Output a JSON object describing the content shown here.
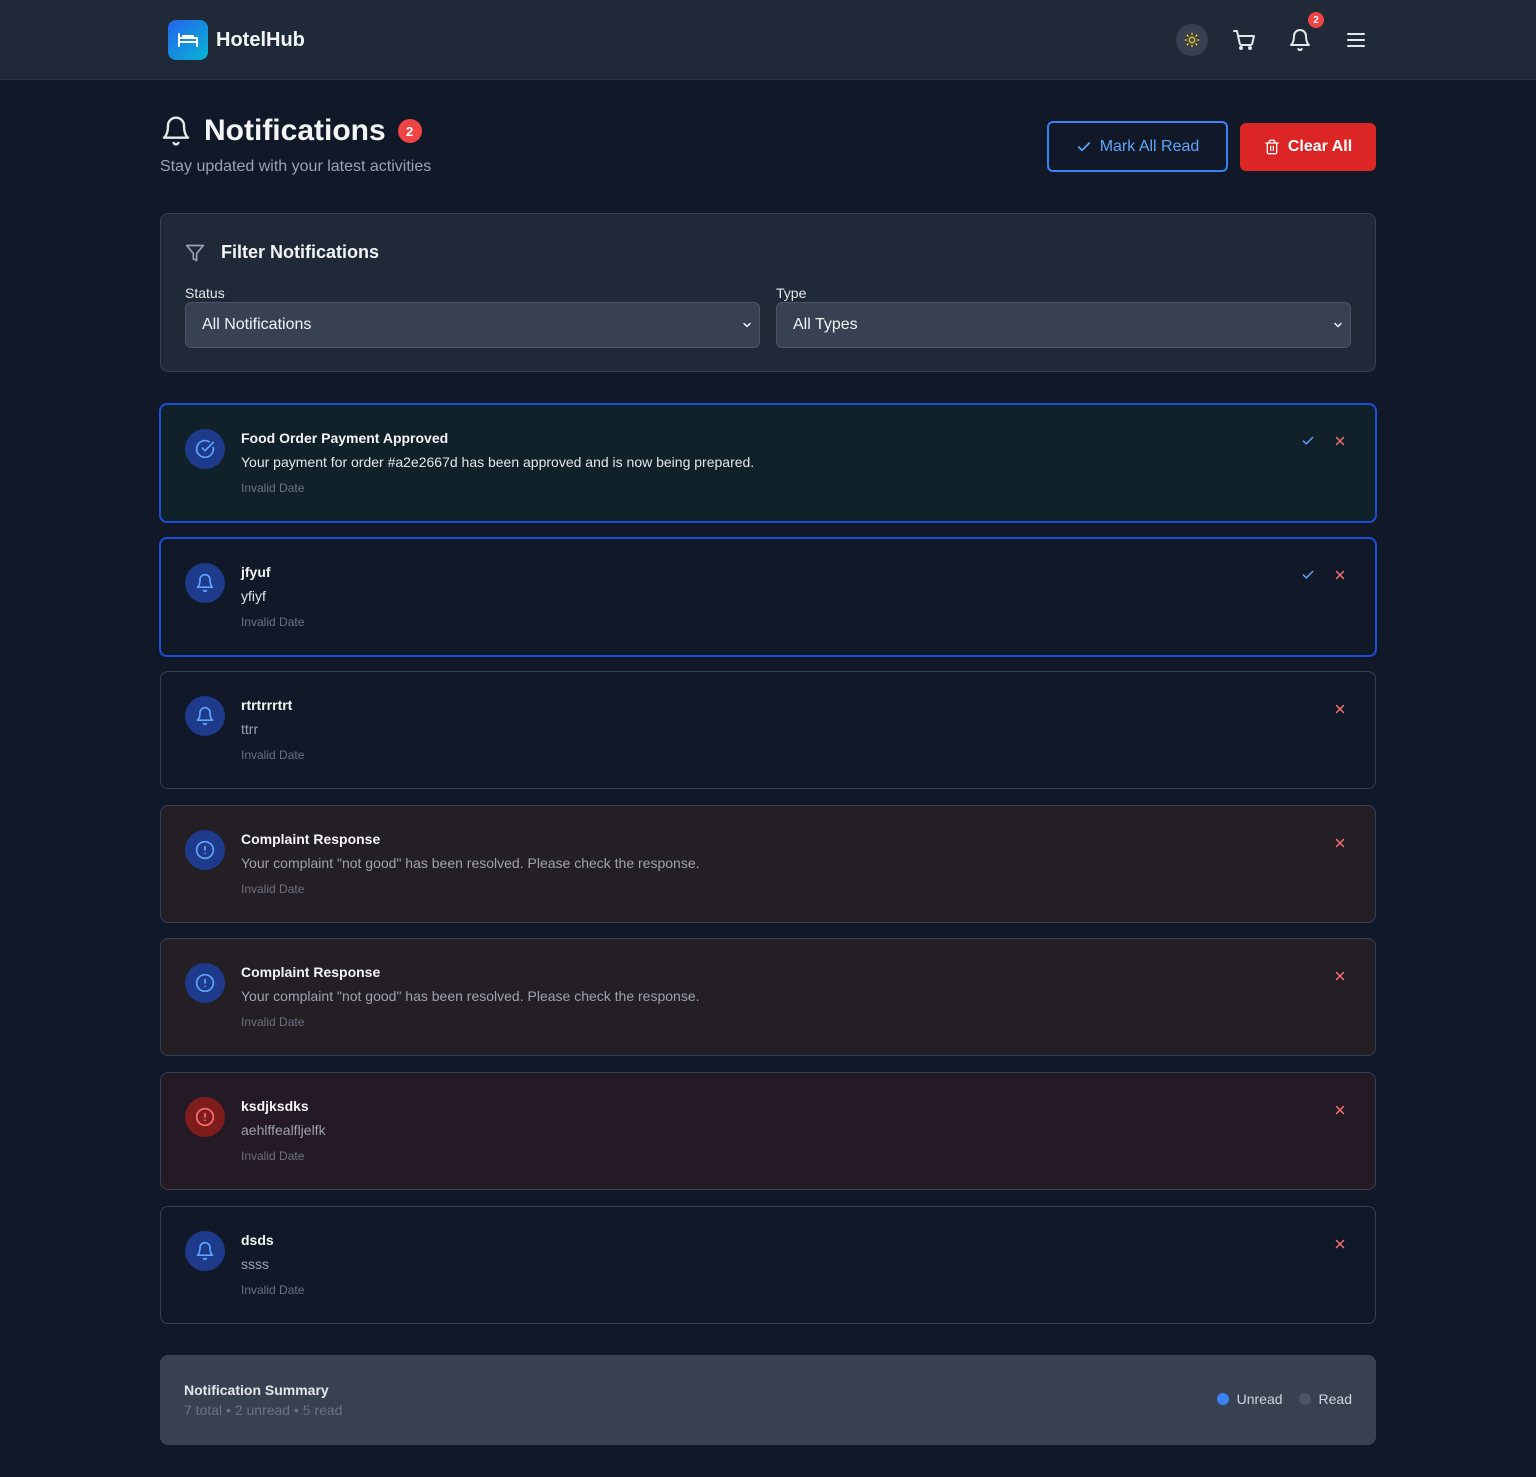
{
  "header": {
    "brand": "HotelHub",
    "notification_count": "2"
  },
  "page": {
    "title": "Notifications",
    "unread_badge": "2",
    "subtitle": "Stay updated with your latest activities",
    "mark_all_read_label": "Mark All Read",
    "clear_all_label": "Clear All"
  },
  "filter": {
    "title": "Filter Notifications",
    "status_label": "Status",
    "status_value": "All Notifications",
    "type_label": "Type",
    "type_value": "All Types"
  },
  "notifications": [
    {
      "title": "Food Order Payment Approved",
      "message": "Your payment for order #a2e2667d has been approved and is now being prepared.",
      "date": "Invalid Date",
      "unread": true,
      "kind": "success",
      "icon": "check-circle-icon"
    },
    {
      "title": "jfyuf",
      "message": "yfiyf",
      "date": "Invalid Date",
      "unread": true,
      "kind": "info",
      "icon": "bell-icon"
    },
    {
      "title": "rtrtrrrtrt",
      "message": "ttrr",
      "date": "Invalid Date",
      "unread": false,
      "kind": "info",
      "icon": "bell-icon"
    },
    {
      "title": "Complaint Response",
      "message": "Your complaint \"not good\" has been resolved. Please check the response.",
      "date": "Invalid Date",
      "unread": false,
      "kind": "warning",
      "icon": "alert-circle-icon"
    },
    {
      "title": "Complaint Response",
      "message": "Your complaint \"not good\" has been resolved. Please check the response.",
      "date": "Invalid Date",
      "unread": false,
      "kind": "warning",
      "icon": "alert-circle-icon"
    },
    {
      "title": "ksdjksdks",
      "message": "aehlffealfljelfk",
      "date": "Invalid Date",
      "unread": false,
      "kind": "error",
      "icon": "alert-circle-icon"
    },
    {
      "title": "dsds",
      "message": "ssss",
      "date": "Invalid Date",
      "unread": false,
      "kind": "info",
      "icon": "bell-icon"
    }
  ],
  "summary": {
    "title": "Notification Summary",
    "stats": "7 total • 2 unread • 5 read",
    "legend_unread": "Unread",
    "legend_read": "Read"
  },
  "colors": {
    "accent": "#3b82f6",
    "danger": "#dc2626",
    "background": "#111827",
    "card": "#1f2937"
  }
}
